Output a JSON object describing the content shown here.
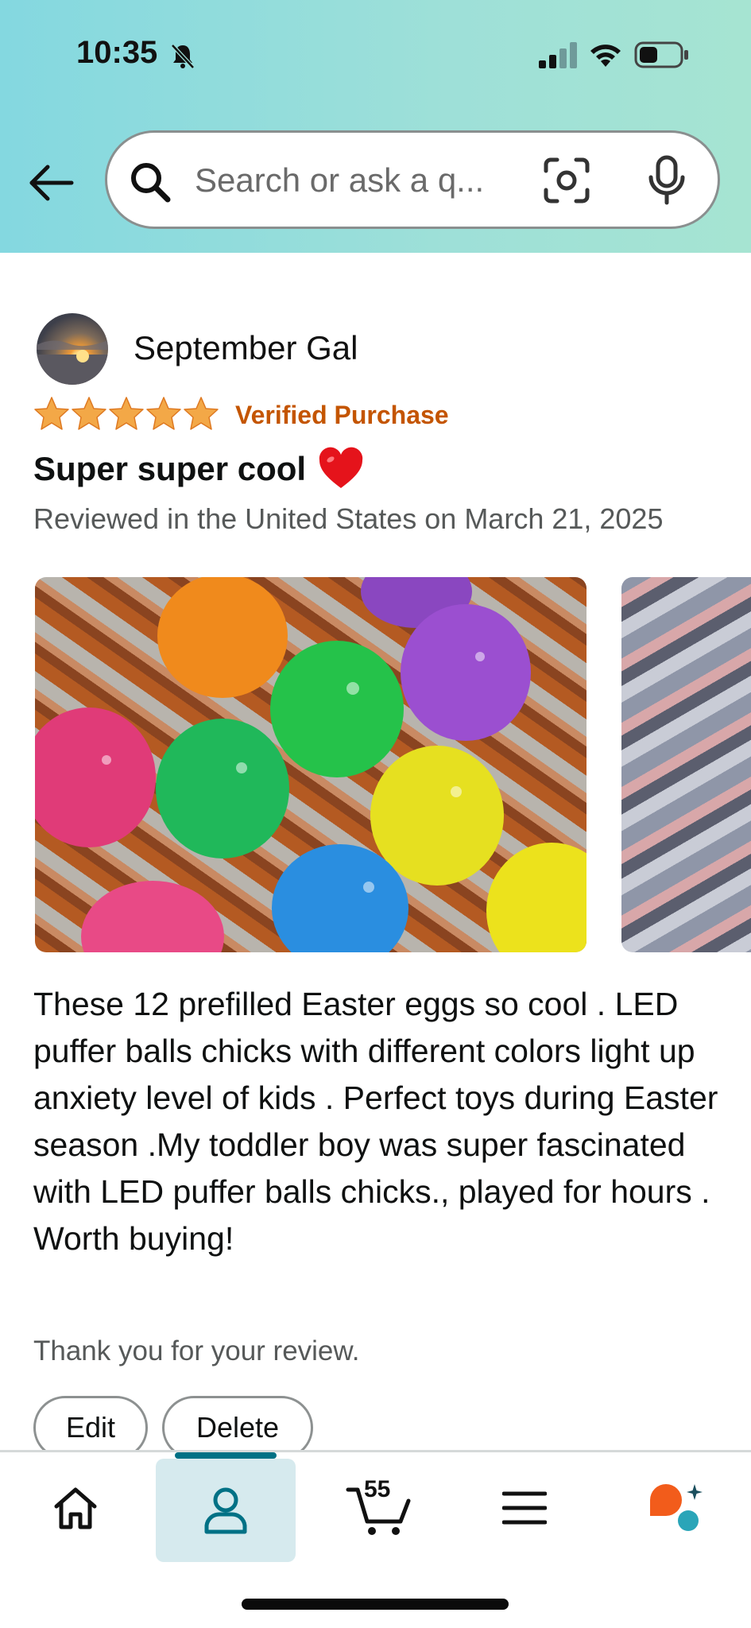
{
  "status_bar": {
    "time": "10:35"
  },
  "search": {
    "placeholder": "Search or ask a q..."
  },
  "review": {
    "reviewer_name": "September Gal",
    "rating_stars": 5,
    "verified_label": "Verified Purchase",
    "title": "Super super cool",
    "date_line": "Reviewed in the United States on March 21, 2025",
    "body": "These 12 prefilled Easter eggs so cool . LED puffer balls chicks with different colors light up anxiety level of kids . Perfect toys during Easter season .My toddler boy was super fascinated with LED puffer balls chicks., played for hours . Worth buying!",
    "thanks_text": "Thank you for your review.",
    "edit_label": "Edit",
    "delete_label": "Delete"
  },
  "bottom_nav": {
    "items": [
      {
        "name": "home",
        "icon": "home-icon"
      },
      {
        "name": "you",
        "icon": "person-icon",
        "selected": true
      },
      {
        "name": "cart",
        "icon": "cart-icon",
        "count": "55"
      },
      {
        "name": "menu",
        "icon": "menu-icon"
      },
      {
        "name": "rufus",
        "icon": "rufus-icon"
      }
    ]
  },
  "colors": {
    "accent_teal": "#007185",
    "verified_orange": "#c45500",
    "star_orange": "#f3a847",
    "header_gradient_start": "#84d8e0",
    "header_gradient_end": "#a6e4d2"
  }
}
